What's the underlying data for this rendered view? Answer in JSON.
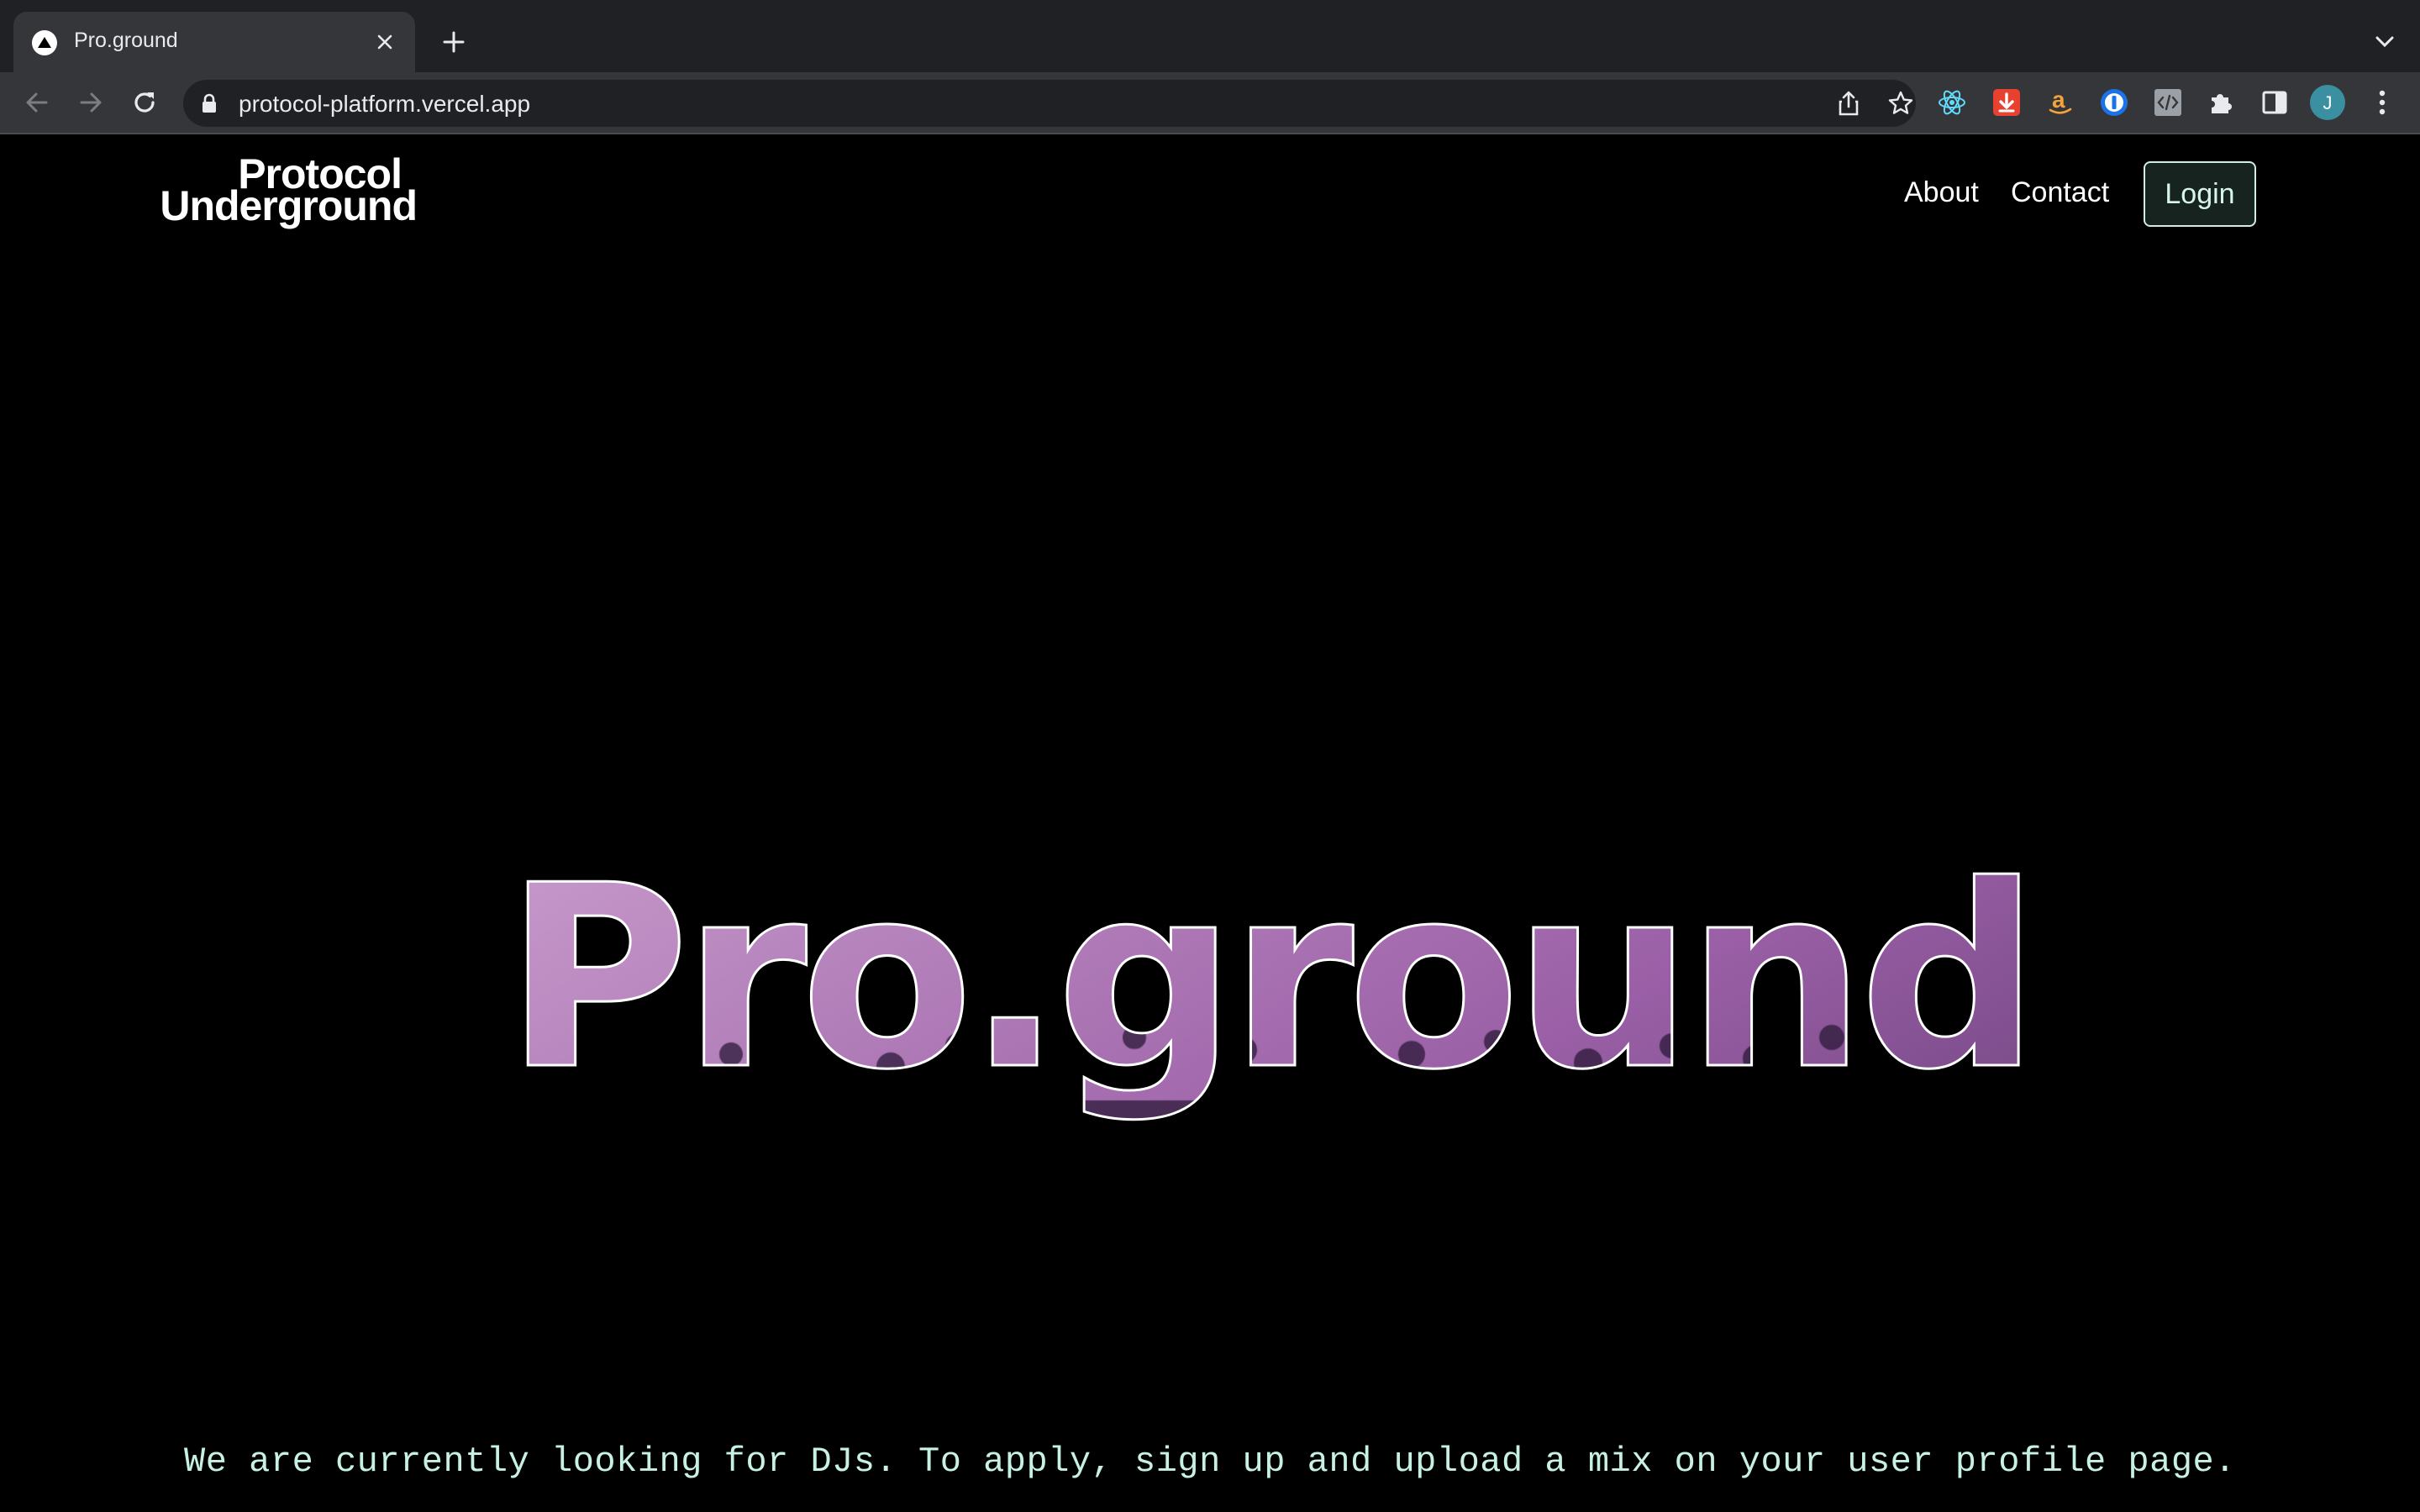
{
  "browser": {
    "tab_title": "Pro.ground",
    "url": "protocol-platform.vercel.app",
    "profile_initial": "J",
    "profile_color": "#3a8fa0"
  },
  "site": {
    "logo_line1": "Protocol",
    "logo_line2": "Underground",
    "nav": {
      "about": "About",
      "contact": "Contact",
      "login": "Login"
    },
    "hero_title": "Pro.ground",
    "tagline": "We are currently looking for DJs. To apply, sign up and upload a mix on your user profile page.",
    "accent_color": "#c6f1e3"
  },
  "icons": [
    "favicon-icon",
    "close-icon",
    "plus-icon",
    "chevron-down-icon",
    "back-icon",
    "forward-icon",
    "reload-icon",
    "lock-icon",
    "share-icon",
    "star-icon",
    "react-devtools-icon",
    "download-icon",
    "amazon-icon",
    "password-manager-icon",
    "code-icon",
    "extensions-icon",
    "side-panel-icon",
    "menu-icon"
  ]
}
